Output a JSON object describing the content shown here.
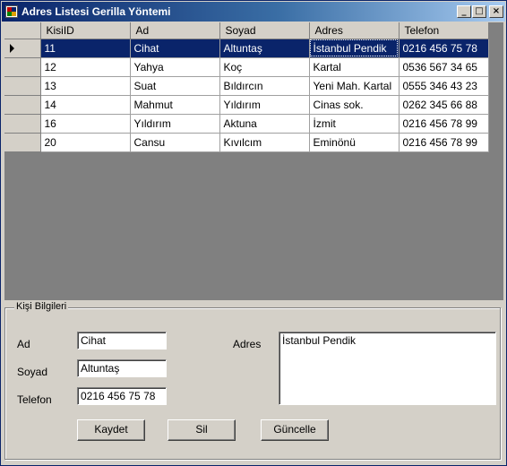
{
  "window": {
    "title": "Adres Listesi Gerilla Yöntemi",
    "controls": {
      "minimize": "_",
      "maximize": "□",
      "close": "×"
    }
  },
  "grid": {
    "columns": [
      "KisiID",
      "Ad",
      "Soyad",
      "Adres",
      "Telefon"
    ],
    "rows": [
      [
        "11",
        "Cihat",
        "Altuntaş",
        "İstanbul Pendik",
        "0216 456 75 78"
      ],
      [
        "12",
        "Yahya",
        "Koç",
        "Kartal",
        "0536 567 34 65"
      ],
      [
        "13",
        "Suat",
        "Bıldırcın",
        "Yeni Mah. Kartal",
        "0555 346 43 23"
      ],
      [
        "14",
        "Mahmut",
        "Yıldırım",
        "Cinas sok.",
        "0262 345 66 88"
      ],
      [
        "16",
        "Yıldırım",
        "Aktuna",
        "İzmit",
        "0216 456 78 99"
      ],
      [
        "20",
        "Cansu",
        "Kıvılcım",
        "Eminönü",
        "0216 456 78 99"
      ]
    ]
  },
  "form": {
    "group_title": "Kişi Bilgileri",
    "ad_label": "Ad",
    "ad_value": "Cihat",
    "soyad_label": "Soyad",
    "soyad_value": "Altuntaş",
    "telefon_label": "Telefon",
    "telefon_value": "0216 456 75 78",
    "adres_label": "Adres",
    "adres_value": "İstanbul Pendik"
  },
  "buttons": {
    "kaydet": "Kaydet",
    "sil": "Sil",
    "guncelle": "Güncelle"
  },
  "colors": {
    "selection": "#0a246a",
    "face": "#d4d0c8",
    "grid_background": "#808080"
  }
}
